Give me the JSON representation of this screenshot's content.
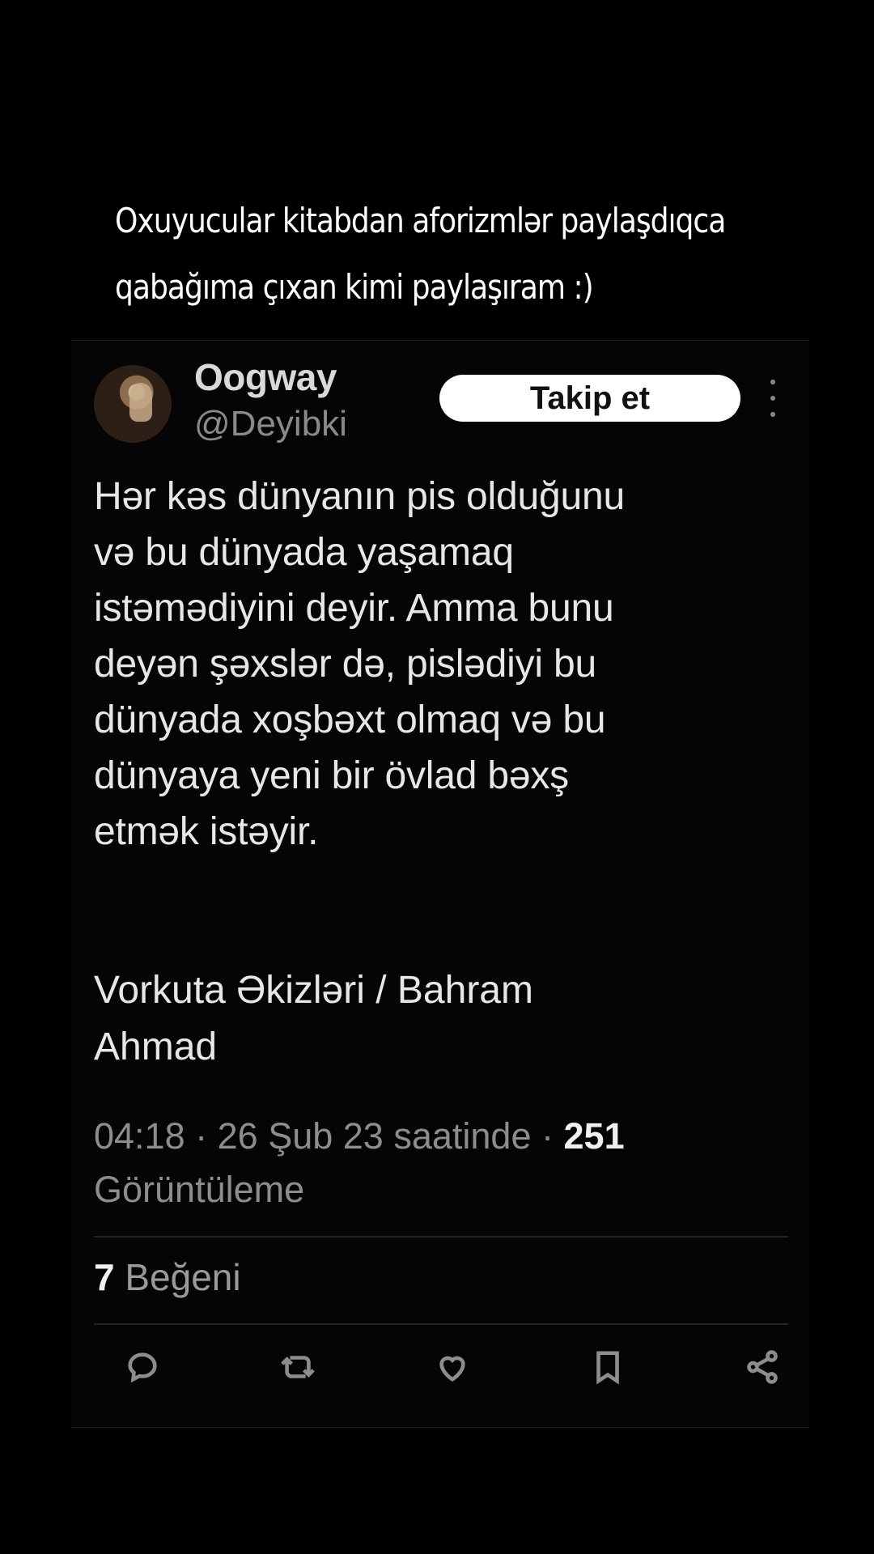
{
  "caption": {
    "line1": "Oxuyucular kitabdan aforizmlər paylaşdıqca",
    "line2": "qabağıma çıxan kimi paylaşıram :)"
  },
  "tweet": {
    "author_name": "Oogway",
    "author_handle": "@Deyibki",
    "follow_label": "Takip et",
    "text": "Hər kəs dünyanın pis olduğunu\nvə bu dünyada yaşamaq\nistəmədiyini deyir. Amma bunu\ndeyən şəxslər də, pislədiyi bu\ndünyada xoşbəxt olmaq və bu\ndünyaya yeni bir övlad bəxş\netmək istəyir.",
    "book": "Vorkuta Əkizləri / Bahram\nAhmad",
    "time": "04:18",
    "date": "26 Şub 23 saatinde",
    "separator": "·",
    "views_count": "251",
    "views_label": "Görüntüleme",
    "likes_count": "7",
    "likes_label": "Beğeni"
  },
  "actions": [
    {
      "icon": "reply-icon"
    },
    {
      "icon": "retweet-icon"
    },
    {
      "icon": "like-icon"
    },
    {
      "icon": "bookmark-icon"
    },
    {
      "icon": "share-icon"
    }
  ],
  "colors": {
    "background": "#000000",
    "text": "#e7e7e7",
    "muted": "#8d8d8d",
    "follow_button": "#ffffff"
  }
}
